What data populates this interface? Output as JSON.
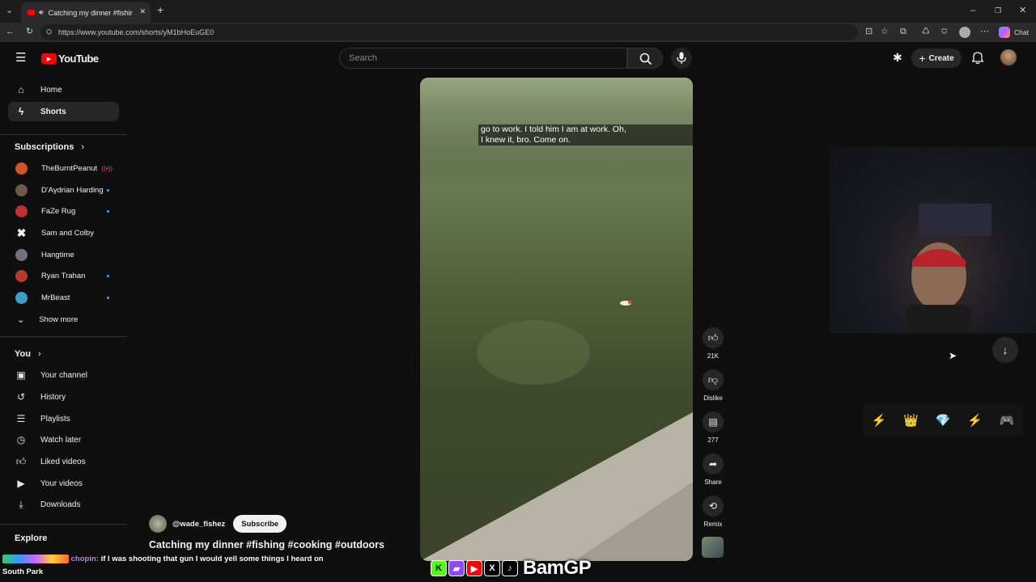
{
  "browser": {
    "tab_title": "Catching my dinner #fishing",
    "url": "https://www.youtube.com/shorts/yM1bHoEuGE0",
    "chat_label": "Chat"
  },
  "header": {
    "logo_text": "YouTube",
    "search_placeholder": "Search",
    "create_label": "Create"
  },
  "sidebar": {
    "main": [
      {
        "label": "Home",
        "icon": "home-icon"
      },
      {
        "label": "Shorts",
        "icon": "shorts-icon",
        "active": true
      }
    ],
    "subscriptions_heading": "Subscriptions",
    "subscriptions": [
      {
        "name": "TheBurntPeanut",
        "color": "#d4522a",
        "live": true
      },
      {
        "name": "D'Aydrian Harding",
        "color": "#6b5a48"
      },
      {
        "name": "FaZe Rug",
        "color": "#c23030"
      },
      {
        "name": "Sam and Colby",
        "color": "#f1f1f1"
      },
      {
        "name": "Hangtime",
        "color": "#7a6c80"
      },
      {
        "name": "Ryan Trahan",
        "color": "#b83a2c"
      },
      {
        "name": "MrBeast",
        "color": "#3aa0c8"
      }
    ],
    "show_more": "Show more",
    "you_heading": "You",
    "you_items": [
      {
        "label": "Your channel",
        "icon": "channel-icon"
      },
      {
        "label": "History",
        "icon": "history-icon"
      },
      {
        "label": "Playlists",
        "icon": "playlists-icon"
      },
      {
        "label": "Watch later",
        "icon": "watch-later-icon"
      },
      {
        "label": "Liked videos",
        "icon": "like-icon"
      },
      {
        "label": "Your videos",
        "icon": "video-icon"
      },
      {
        "label": "Downloads",
        "icon": "download-icon"
      }
    ],
    "explore_heading": "Explore"
  },
  "video": {
    "caption_line1": "go to work. I told him I am at work. Oh,",
    "caption_line2": "I knew it, bro. Come on.",
    "channel": "@wade_fishez",
    "subscribe": "Subscribe",
    "title": "Catching my dinner #fishing #cooking #outdoors"
  },
  "actions": {
    "likes": "21K",
    "dislike": "Dislike",
    "comments": "277",
    "share": "Share",
    "remix": "Remix"
  },
  "overlay": {
    "chat_user": "chopin:",
    "chat_message": "if I was shooting that gun I would yell some things I heard on South Park",
    "brand": "BamGP",
    "rewards": [
      "⚡",
      "👑",
      "💎",
      "⚡",
      "🎮"
    ]
  }
}
